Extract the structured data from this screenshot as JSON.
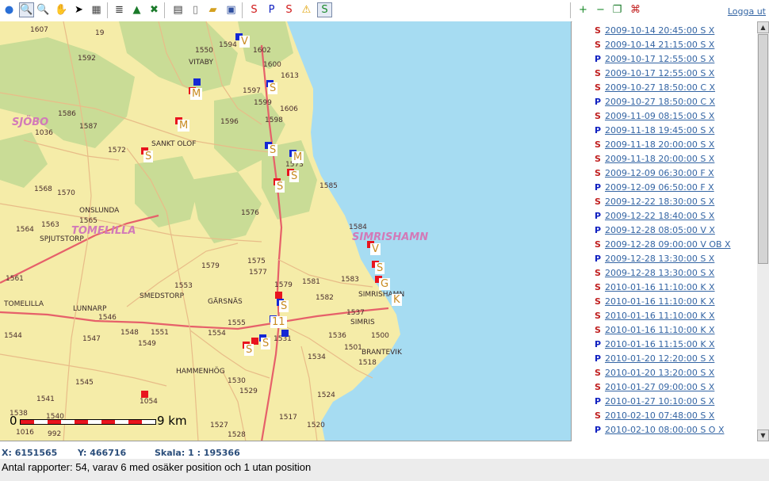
{
  "toolbar": {
    "tools": [
      {
        "icon": "globe-icon",
        "glyph": "●",
        "color": "#2a6fd6"
      },
      {
        "icon": "zoom-in-icon",
        "glyph": "🔍",
        "color": "#333333",
        "active": true
      },
      {
        "icon": "zoom-out-icon",
        "glyph": "🔍",
        "color": "#333333"
      },
      {
        "icon": "pan-hand-icon",
        "glyph": "✋",
        "color": "#333333"
      },
      {
        "icon": "pointer-icon",
        "glyph": "➤",
        "color": "#000000"
      },
      {
        "icon": "measure-icon",
        "glyph": "▦",
        "color": "#444444"
      },
      {
        "icon": "layers-icon",
        "glyph": "≣",
        "color": "#333333"
      },
      {
        "icon": "map-icon",
        "glyph": "▲",
        "color": "#1a7a2a"
      },
      {
        "icon": "delete-marker-icon",
        "glyph": "✖",
        "color": "#1a7a2a"
      },
      {
        "icon": "table-icon",
        "glyph": "▤",
        "color": "#333333"
      },
      {
        "icon": "new-document-icon",
        "glyph": "▯",
        "color": "#777777"
      },
      {
        "icon": "open-folder-icon",
        "glyph": "▰",
        "color": "#d4a020"
      },
      {
        "icon": "save-icon",
        "glyph": "▣",
        "color": "#3050a0"
      },
      {
        "icon": "filter-s-icon",
        "glyph": "S",
        "color": "#d01818"
      },
      {
        "icon": "filter-p-icon",
        "glyph": "P",
        "color": "#1020c0"
      },
      {
        "icon": "filter-sp-icon",
        "glyph": "S",
        "color": "#d01818"
      },
      {
        "icon": "warning-icon",
        "glyph": "⚠",
        "color": "#e0a000"
      },
      {
        "icon": "filter-dots-icon",
        "glyph": "S",
        "color": "#1a8a2a",
        "active": true
      },
      {
        "icon": "plus-icon",
        "glyph": "+",
        "color": "#1a8a2a"
      },
      {
        "icon": "minus-icon",
        "glyph": "−",
        "color": "#1a8a2a"
      },
      {
        "icon": "copy-icon",
        "glyph": "❐",
        "color": "#1a7a2a"
      },
      {
        "icon": "pdf-icon",
        "glyph": "⌘",
        "color": "#c01818"
      }
    ],
    "logout_label": "Logga ut"
  },
  "map": {
    "places": [
      {
        "name": "VITABY",
        "cls": "place"
      },
      {
        "name": "SANKT OLOF",
        "cls": "place"
      },
      {
        "name": "ONSLUNDA",
        "cls": "place"
      },
      {
        "name": "SPJUTSTORP",
        "cls": "place"
      },
      {
        "name": "SMEDSTORP",
        "cls": "place"
      },
      {
        "name": "LUNNARP",
        "cls": "place"
      },
      {
        "name": "GÄRSNÄS",
        "cls": "place"
      },
      {
        "name": "HAMMENHÖG",
        "cls": "place"
      },
      {
        "name": "SIMRISHAMN",
        "cls": "place"
      },
      {
        "name": "SIMRIS",
        "cls": "place"
      },
      {
        "name": "BRANTEVIK",
        "cls": "place"
      },
      {
        "name": "TOMELILLA",
        "cls": "place"
      },
      {
        "name": "SJÖBO",
        "cls": "town"
      },
      {
        "name": "TOMELILLA",
        "cls": "town"
      },
      {
        "name": "SIMRISHAMN",
        "cls": "town"
      }
    ],
    "road_numbers": [
      "1607",
      "19",
      "1594",
      "1602",
      "1592",
      "1550",
      "1600",
      "1613",
      "1597",
      "1606",
      "1599",
      "1586",
      "1587",
      "1036",
      "1596",
      "1598",
      "1572",
      "1573",
      "1585",
      "1568",
      "1570",
      "1576",
      "1565",
      "1563",
      "1564",
      "1584",
      "1561",
      "1579",
      "1575",
      "1577",
      "1553",
      "1579",
      "1581",
      "1583",
      "1582",
      "1544",
      "1547",
      "1548",
      "1551",
      "1554",
      "1555",
      "1537",
      "1546",
      "1549",
      "1531",
      "1536",
      "1501",
      "1500",
      "1534",
      "1518",
      "1545",
      "1530",
      "1529",
      "1524",
      "1541",
      "1054",
      "1538",
      "1540",
      "1016",
      "992",
      "1527",
      "1517",
      "1520",
      "1528"
    ],
    "marker_letters": [
      "V",
      "M",
      "M",
      "S",
      "S",
      "S",
      "S",
      "M",
      "S",
      "V",
      "S",
      "G",
      "K",
      "S",
      "11",
      "S",
      "S"
    ],
    "scale": {
      "zero": "0",
      "km": "9 km"
    }
  },
  "reports": [
    {
      "type": "S",
      "text": "2009-10-14 20:45:00 S X"
    },
    {
      "type": "S",
      "text": "2009-10-14 21:15:00 S X"
    },
    {
      "type": "P",
      "text": "2009-10-17 12:55:00 S X"
    },
    {
      "type": "S",
      "text": "2009-10-17 12:55:00 S X"
    },
    {
      "type": "S",
      "text": "2009-10-27 18:50:00 C X"
    },
    {
      "type": "P",
      "text": "2009-10-27 18:50:00 C X"
    },
    {
      "type": "S",
      "text": "2009-11-09 08:15:00 S X"
    },
    {
      "type": "P",
      "text": "2009-11-18 19:45:00 S X"
    },
    {
      "type": "S",
      "text": "2009-11-18 20:00:00 S X"
    },
    {
      "type": "S",
      "text": "2009-11-18 20:00:00 S X"
    },
    {
      "type": "S",
      "text": "2009-12-09 06:30:00 F X"
    },
    {
      "type": "P",
      "text": "2009-12-09 06:50:00 F X"
    },
    {
      "type": "S",
      "text": "2009-12-22 18:30:00 S X"
    },
    {
      "type": "P",
      "text": "2009-12-22 18:40:00 S X"
    },
    {
      "type": "P",
      "text": "2009-12-28 08:05:00 V X"
    },
    {
      "type": "S",
      "text": "2009-12-28 09:00:00 V OB X"
    },
    {
      "type": "P",
      "text": "2009-12-28 13:30:00 S X"
    },
    {
      "type": "S",
      "text": "2009-12-28 13:30:00 S X"
    },
    {
      "type": "S",
      "text": "2010-01-16 11:10:00 K X"
    },
    {
      "type": "S",
      "text": "2010-01-16 11:10:00 K X"
    },
    {
      "type": "S",
      "text": "2010-01-16 11:10:00 K X"
    },
    {
      "type": "S",
      "text": "2010-01-16 11:10:00 K X"
    },
    {
      "type": "P",
      "text": "2010-01-16 11:15:00 K X"
    },
    {
      "type": "P",
      "text": "2010-01-20 12:20:00 S X"
    },
    {
      "type": "S",
      "text": "2010-01-20 13:20:00 S X"
    },
    {
      "type": "S",
      "text": "2010-01-27 09:00:00 S X"
    },
    {
      "type": "P",
      "text": "2010-01-27 10:10:00 S X"
    },
    {
      "type": "S",
      "text": "2010-02-10 07:48:00 S X"
    },
    {
      "type": "P",
      "text": "2010-02-10 08:00:00 S O X"
    }
  ],
  "status": {
    "x_label": "X: 6151565",
    "y_label": "Y: 466716",
    "scale_label": "Skala: 1 : 195366",
    "summary": "Antal rapporter: 54, varav 6 med osäker position och 1 utan position"
  },
  "colors": {
    "land": "#f5eca8",
    "forest": "#c9dc96",
    "sea": "#a6dcf2",
    "road_major": "#e6606a",
    "road_minor": "#e8bc88",
    "link": "#3465a4"
  }
}
